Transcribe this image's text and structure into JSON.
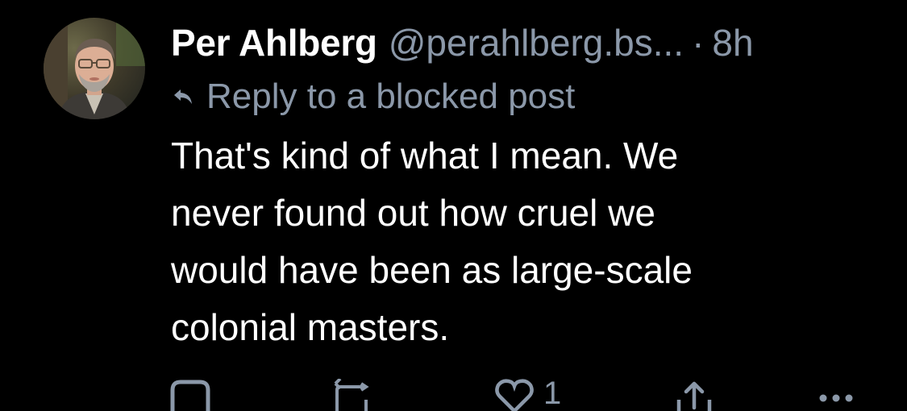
{
  "post": {
    "author": {
      "display_name": "Per Ahlberg",
      "handle": "@perahlberg.bs...",
      "separator": "·",
      "timestamp": "8h",
      "avatar_icon": "user-avatar-photo"
    },
    "reply_context": {
      "icon": "reply-arrow-icon",
      "text": "Reply to a blocked post"
    },
    "text_lines": [
      "That's kind of what I mean. We",
      "never found out how cruel we",
      "would have been as large-scale",
      "colonial masters."
    ],
    "actions": {
      "reply_icon": "comment-icon",
      "repost_icon": "repost-icon",
      "like_icon": "heart-icon",
      "like_count": "1",
      "share_icon": "share-icon",
      "more_icon": "more-options-icon"
    }
  },
  "colors": {
    "background": "#000000",
    "primary_text": "#ffffff",
    "secondary_text": "#8b98a9"
  }
}
